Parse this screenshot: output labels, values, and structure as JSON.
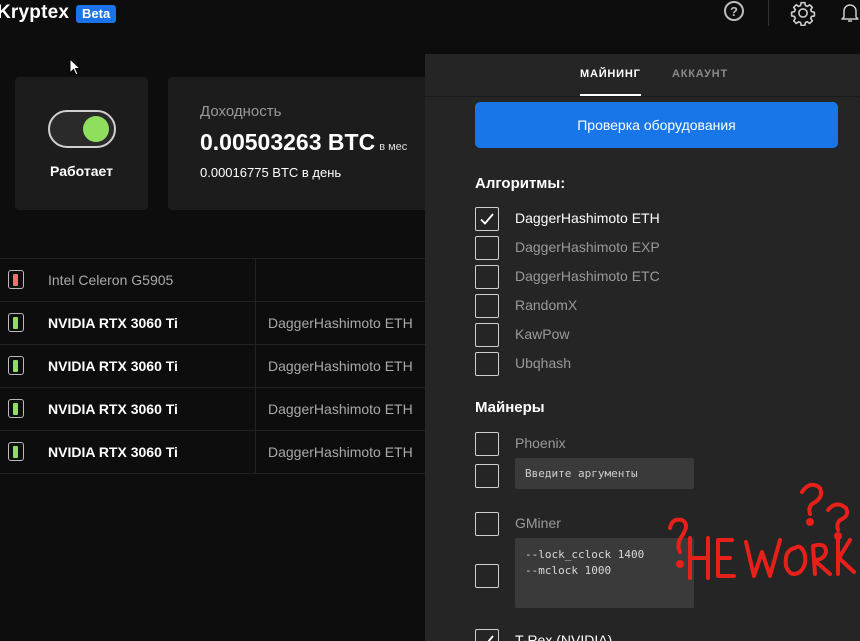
{
  "app": {
    "name": "Kryptex",
    "badge": "Beta"
  },
  "status": {
    "label": "Работает",
    "running": true
  },
  "earnings": {
    "title": "Доходность",
    "value": "0.00503263 BTC",
    "unit": "в мес",
    "per_day": "0.00016775 BTC в день"
  },
  "devices": [
    {
      "name": "Intel Celeron G5905",
      "algorithm": "",
      "state": "off",
      "indicator_color": "#f07070"
    },
    {
      "name": "NVIDIA RTX 3060 Ti",
      "algorithm": "DaggerHashimoto ETH",
      "state": "on",
      "indicator_color": "#8fde5d"
    },
    {
      "name": "NVIDIA RTX 3060 Ti",
      "algorithm": "DaggerHashimoto ETH",
      "state": "on",
      "indicator_color": "#8fde5d"
    },
    {
      "name": "NVIDIA RTX 3060 Ti",
      "algorithm": "DaggerHashimoto ETH",
      "state": "on",
      "indicator_color": "#8fde5d"
    },
    {
      "name": "NVIDIA RTX 3060 Ti",
      "algorithm": "DaggerHashimoto ETH",
      "state": "on",
      "indicator_color": "#8fde5d"
    }
  ],
  "settings": {
    "tabs": [
      {
        "label": "МАЙНИНГ",
        "active": true
      },
      {
        "label": "АККАУНТ",
        "active": false
      }
    ],
    "check_button": "Проверка оборудования",
    "algorithms_title": "Алгоритмы:",
    "algorithms": [
      {
        "label": "DaggerHashimoto ETH",
        "checked": true
      },
      {
        "label": "DaggerHashimoto EXP",
        "checked": false
      },
      {
        "label": "DaggerHashimoto ETC",
        "checked": false
      },
      {
        "label": "RandomX",
        "checked": false
      },
      {
        "label": "KawPow",
        "checked": false
      },
      {
        "label": "Ubqhash",
        "checked": false
      }
    ],
    "miners_title": "Майнеры",
    "miners": [
      {
        "label": "Phoenix",
        "checked": false,
        "args_placeholder": "Введите аргументы",
        "args_value": ""
      },
      {
        "label": "GMiner",
        "checked": false,
        "args_value": "--lock_cclock 1400\n--mclock 1000"
      },
      {
        "label": "T-Rex (NVIDIA)",
        "checked": true
      }
    ]
  },
  "annotation": {
    "text": "НЕ WORK",
    "color": "#e8201a"
  },
  "colors": {
    "accent": "#1976e8",
    "on": "#8fde5d",
    "off": "#f07070",
    "panel": "#252525",
    "background": "#0d0d0d"
  },
  "icons": [
    "help-icon",
    "gear-icon",
    "bell-icon",
    "cursor-icon",
    "check-icon"
  ]
}
